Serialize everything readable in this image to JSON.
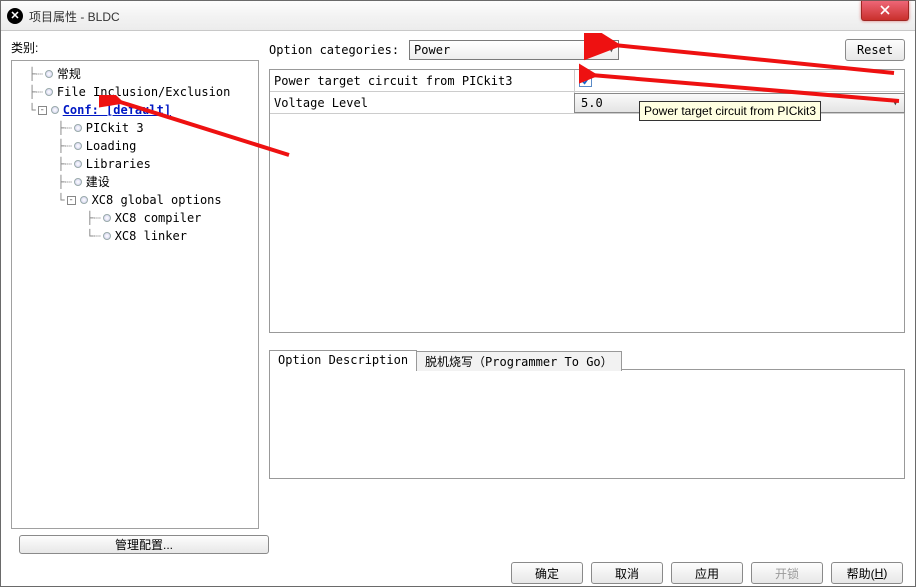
{
  "window": {
    "title": "项目属性 - BLDC"
  },
  "left": {
    "label": "类别:",
    "tree": {
      "general": "常规",
      "file_incl": "File Inclusion/Exclusion",
      "conf": "Conf: [default]",
      "pickit3": "PICkit 3",
      "loading": "Loading",
      "libraries": "Libraries",
      "build": "建设",
      "xc8_glob": "XC8 global options",
      "xc8_comp": "XC8 compiler",
      "xc8_link": "XC8 linker"
    },
    "manage_btn": "管理配置..."
  },
  "options": {
    "categories_label": "Option categories:",
    "category_value": "Power",
    "reset": "Reset",
    "rows": {
      "power_target": "Power target circuit from PICkit3",
      "voltage_level_label": "Voltage Level",
      "voltage_level_value": "5.0"
    },
    "tooltip": "Power target circuit from PICkit3"
  },
  "tabs": {
    "desc": "Option Description",
    "ptg": "脱机烧写（Programmer To Go）"
  },
  "buttons": {
    "ok": "确定",
    "cancel": "取消",
    "apply": "应用",
    "unlock_pre": "开锁",
    "help_pre": "帮助(",
    "help_u": "H",
    "help_post": ")"
  }
}
